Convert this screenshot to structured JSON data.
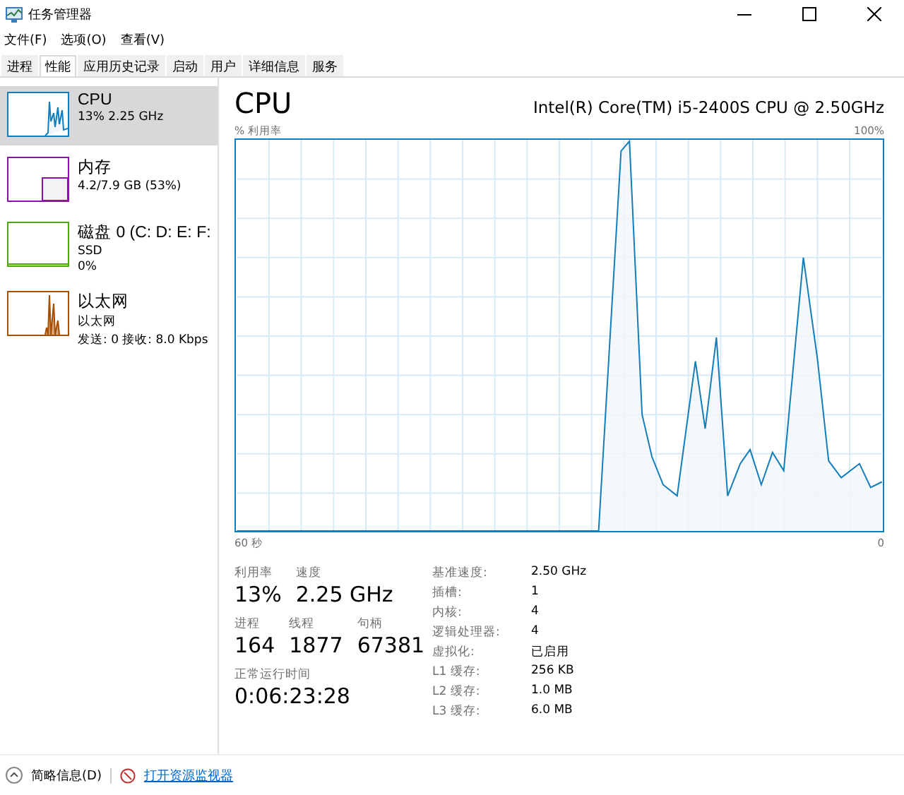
{
  "window": {
    "title": "任务管理器"
  },
  "menu": [
    "文件(F)",
    "选项(O)",
    "查看(V)"
  ],
  "tabs": [
    {
      "label": "进程",
      "selected": false
    },
    {
      "label": "性能",
      "selected": true
    },
    {
      "label": "应用历史记录",
      "selected": false
    },
    {
      "label": "启动",
      "selected": false
    },
    {
      "label": "用户",
      "selected": false
    },
    {
      "label": "详细信息",
      "selected": false
    },
    {
      "label": "服务",
      "selected": false
    }
  ],
  "sidebar": {
    "items": [
      {
        "kind": "cpu",
        "title": "CPU",
        "lines": [
          "13% 2.25 GHz"
        ],
        "color": "#117dbb",
        "selected": true
      },
      {
        "kind": "memory",
        "title": "内存",
        "lines": [
          "4.2/7.9 GB (53%)"
        ],
        "color": "#8b12ae",
        "selected": false
      },
      {
        "kind": "disk",
        "title": "磁盘 0 (C: D: E: F:",
        "lines": [
          "SSD",
          "0%"
        ],
        "color": "#4da60c",
        "selected": false
      },
      {
        "kind": "network",
        "title": "以太网",
        "lines": [
          "以太网",
          "发送: 0 接收: 8.0 Kbps"
        ],
        "color": "#a74f01",
        "selected": false
      }
    ]
  },
  "panel": {
    "title": "CPU",
    "model": "Intel(R) Core(TM) i5-2400S CPU @ 2.50GHz",
    "graph_label": "% 利用率",
    "graph_max": "100%",
    "graph_time": "60 秒",
    "graph_min": "0",
    "stats_rows": [
      [
        {
          "label": "利用率",
          "value": "13%"
        },
        {
          "label": "速度",
          "value": "2.25 GHz"
        }
      ],
      [
        {
          "label": "进程",
          "value": "164"
        },
        {
          "label": "线程",
          "value": "1877"
        },
        {
          "label": "句柄",
          "value": "67381"
        }
      ],
      [
        {
          "label": "正常运行时间",
          "value": "0:06:23:28"
        }
      ]
    ],
    "details": [
      {
        "label": "基准速度:",
        "value": "2.50 GHz"
      },
      {
        "label": "插槽:",
        "value": "1"
      },
      {
        "label": "内核:",
        "value": "4"
      },
      {
        "label": "逻辑处理器:",
        "value": "4"
      },
      {
        "label": "虚拟化:",
        "value": "已启用"
      },
      {
        "label": "L1 缓存:",
        "value": "256 KB"
      },
      {
        "label": "L2 缓存:",
        "value": "1.0 MB"
      },
      {
        "label": "L3 缓存:",
        "value": "6.0 MB"
      }
    ]
  },
  "footer": {
    "summary": "简略信息(D)",
    "link": "打开资源监视器"
  }
}
